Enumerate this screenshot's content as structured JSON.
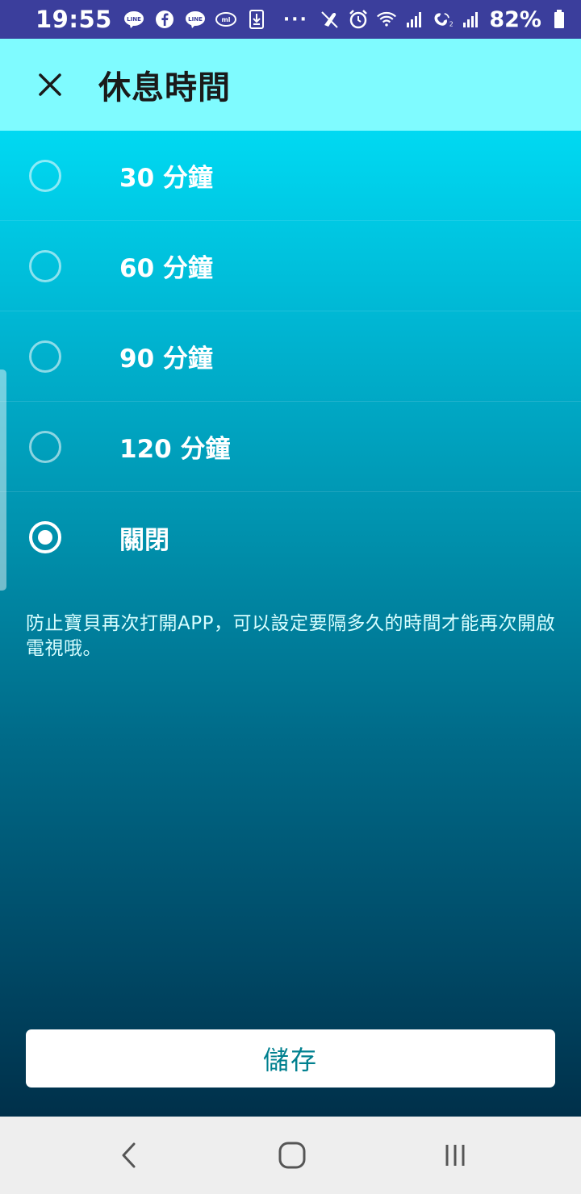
{
  "status_bar": {
    "time": "19:55",
    "battery": "82%",
    "left_icons": [
      "line-icon",
      "facebook-icon",
      "line-icon",
      "mail-icon",
      "download-icon"
    ],
    "more": "···",
    "right_icons": [
      "silent-icon",
      "alarm-icon",
      "wifi-icon",
      "signal-icon",
      "wifi-calling-icon",
      "signal-icon",
      "battery-icon"
    ]
  },
  "header": {
    "title": "休息時間",
    "close_icon": "close-icon"
  },
  "options": [
    {
      "label": "30 分鐘",
      "selected": false
    },
    {
      "label": "60 分鐘",
      "selected": false
    },
    {
      "label": "90 分鐘",
      "selected": false
    },
    {
      "label": "120 分鐘",
      "selected": false
    },
    {
      "label": "關閉",
      "selected": true
    }
  ],
  "description": "防止寶貝再次打開APP，可以設定要隔多久的時間才能再次開啟電視哦。",
  "save_label": "儲存",
  "nav": [
    "back-icon",
    "home-icon",
    "recent-apps-icon"
  ],
  "colors": {
    "status_bar": "#3b3e9c",
    "header": "#7ffbff",
    "gradient_top": "#00d9f2",
    "gradient_bottom": "#00304a",
    "save_text": "#00808f"
  }
}
